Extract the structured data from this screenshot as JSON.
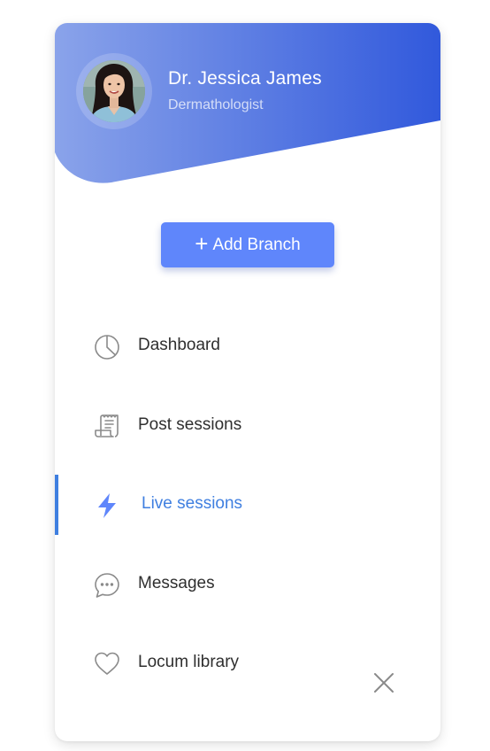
{
  "profile": {
    "name": "Dr. Jessica James",
    "role": "Dermathologist",
    "avatar_icon": "doctor-portrait"
  },
  "actions": {
    "add_branch_label": "Add Branch",
    "add_branch_icon": "plus-icon"
  },
  "nav": {
    "items": [
      {
        "label": "Dashboard",
        "icon": "pie-chart-icon",
        "active": false
      },
      {
        "label": "Post sessions",
        "icon": "receipt-icon",
        "active": false
      },
      {
        "label": "Live sessions",
        "icon": "lightning-icon",
        "active": true
      },
      {
        "label": "Messages",
        "icon": "chat-bubble-icon",
        "active": false
      },
      {
        "label": "Locum library",
        "icon": "heart-icon",
        "active": false
      }
    ]
  },
  "close_icon": "close-icon",
  "colors": {
    "header_gradient_start": "#8aa3ea",
    "header_gradient_end": "#3159dc",
    "accent": "#3f7fe0",
    "button": "#5f86fb",
    "text": "#2f2f2f",
    "icon": "#8a8a8a"
  }
}
